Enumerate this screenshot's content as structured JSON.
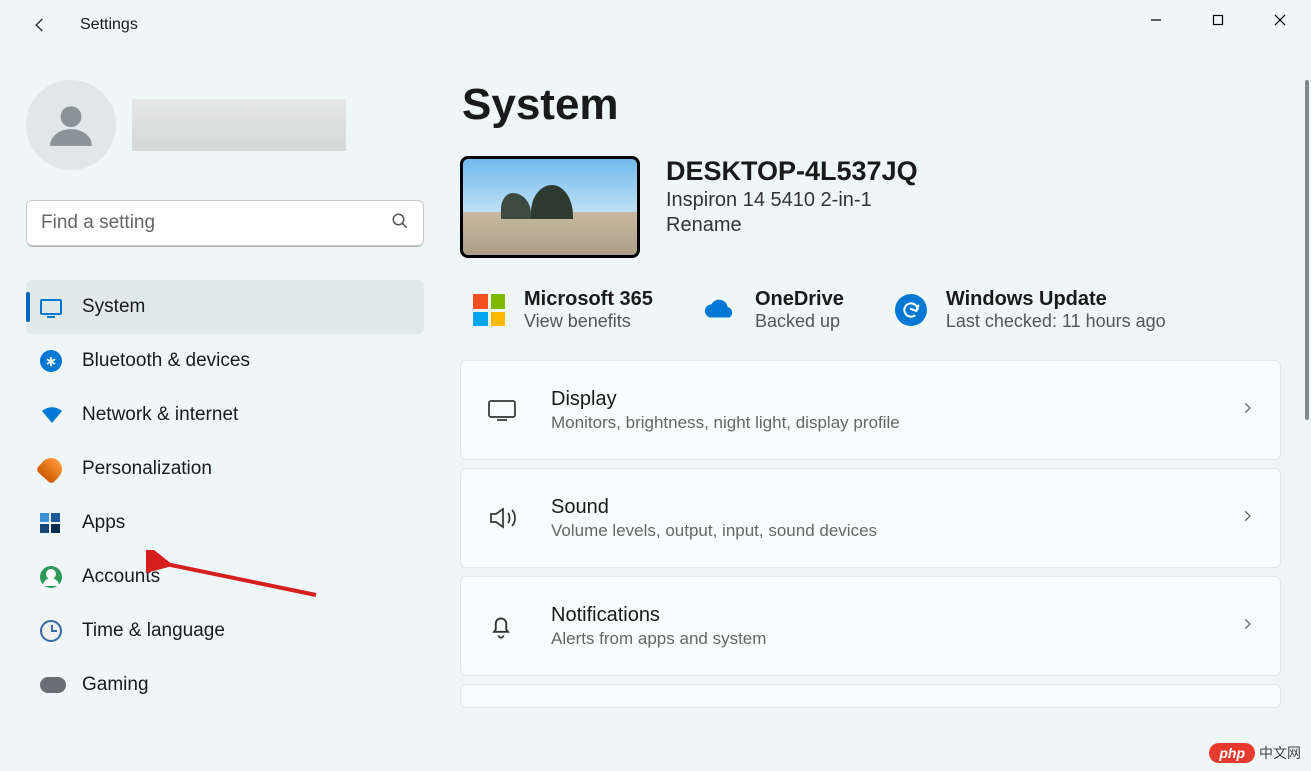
{
  "window": {
    "title": "Settings"
  },
  "search": {
    "placeholder": "Find a setting"
  },
  "nav": {
    "items": [
      {
        "label": "System"
      },
      {
        "label": "Bluetooth & devices"
      },
      {
        "label": "Network & internet"
      },
      {
        "label": "Personalization"
      },
      {
        "label": "Apps"
      },
      {
        "label": "Accounts"
      },
      {
        "label": "Time & language"
      },
      {
        "label": "Gaming"
      }
    ],
    "selected_index": 0
  },
  "page": {
    "title": "System",
    "device": {
      "name": "DESKTOP-4L537JQ",
      "model": "Inspiron 14 5410 2-in-1",
      "rename_label": "Rename"
    },
    "status": [
      {
        "title": "Microsoft 365",
        "subtitle": "View benefits"
      },
      {
        "title": "OneDrive",
        "subtitle": "Backed up"
      },
      {
        "title": "Windows Update",
        "subtitle": "Last checked: 11 hours ago"
      }
    ],
    "cards": [
      {
        "title": "Display",
        "subtitle": "Monitors, brightness, night light, display profile"
      },
      {
        "title": "Sound",
        "subtitle": "Volume levels, output, input, sound devices"
      },
      {
        "title": "Notifications",
        "subtitle": "Alerts from apps and system"
      }
    ]
  },
  "watermark": {
    "badge": "php",
    "text": "中文网"
  }
}
